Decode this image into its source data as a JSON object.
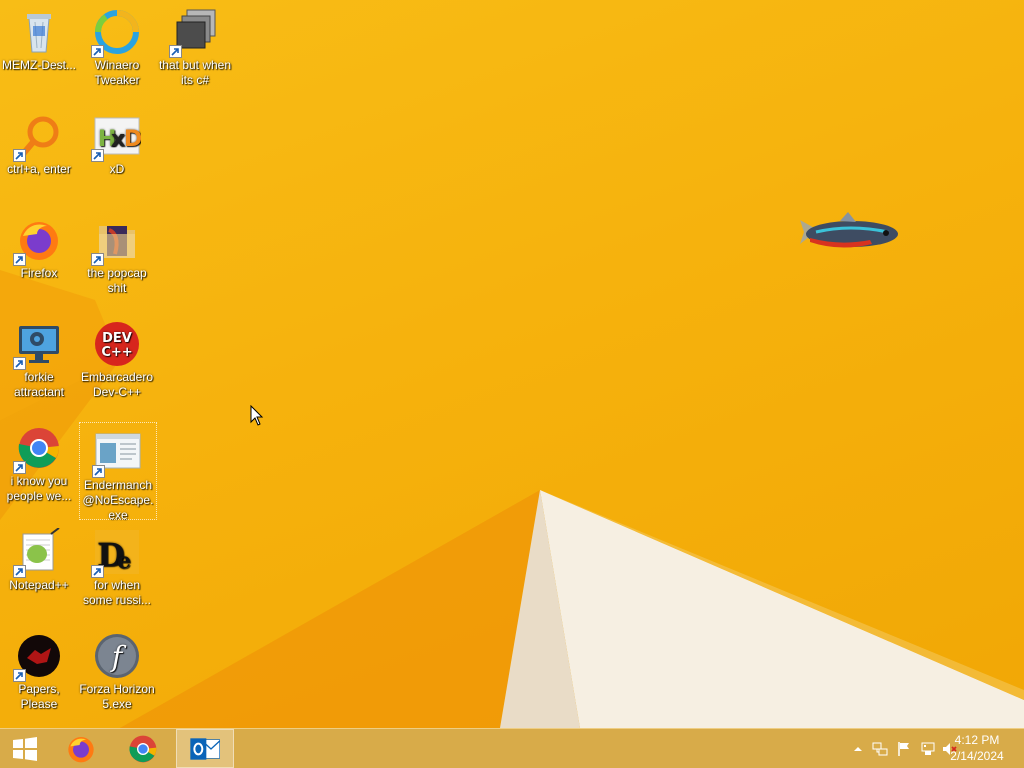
{
  "desktop": {
    "icons": [
      {
        "label": "MEMZ-Dest...",
        "icon": "recycle-bin-icon"
      },
      {
        "label": "Winaero Tweaker",
        "icon": "winaero-icon"
      },
      {
        "label": "that but when its c#",
        "icon": "stacked-windows-icon"
      },
      {
        "label": "ctrl+a, enter",
        "icon": "magnifier-ring-icon"
      },
      {
        "label": "xD",
        "icon": "hxd-icon"
      },
      {
        "label": "Firefox",
        "icon": "firefox-icon"
      },
      {
        "label": "the popcap shit",
        "icon": "folder-icon"
      },
      {
        "label": "forkie attractant",
        "icon": "monitor-gear-icon"
      },
      {
        "label": "Embarcadero Dev-C++",
        "icon": "devcpp-icon"
      },
      {
        "label": "i know you people we...",
        "icon": "chrome-icon"
      },
      {
        "label": "Endermanch @NoEscape.exe",
        "icon": "window-app-icon"
      },
      {
        "label": "Notepad++",
        "icon": "notepadpp-icon"
      },
      {
        "label": "for when some russi...",
        "icon": "de-icon"
      },
      {
        "label": "Papers, Please",
        "icon": "papers-please-icon"
      },
      {
        "label": "Forza Horizon 5.exe",
        "icon": "flash-icon"
      }
    ]
  },
  "taskbar": {
    "start": "start-button",
    "pinned": [
      "Firefox",
      "Google Chrome",
      "Outlook"
    ],
    "tray": {
      "time": "4:12 PM",
      "date": "2/14/2024"
    }
  },
  "colors": {
    "wallpaper": "#f6b20d",
    "taskbar": "#d6a842"
  }
}
